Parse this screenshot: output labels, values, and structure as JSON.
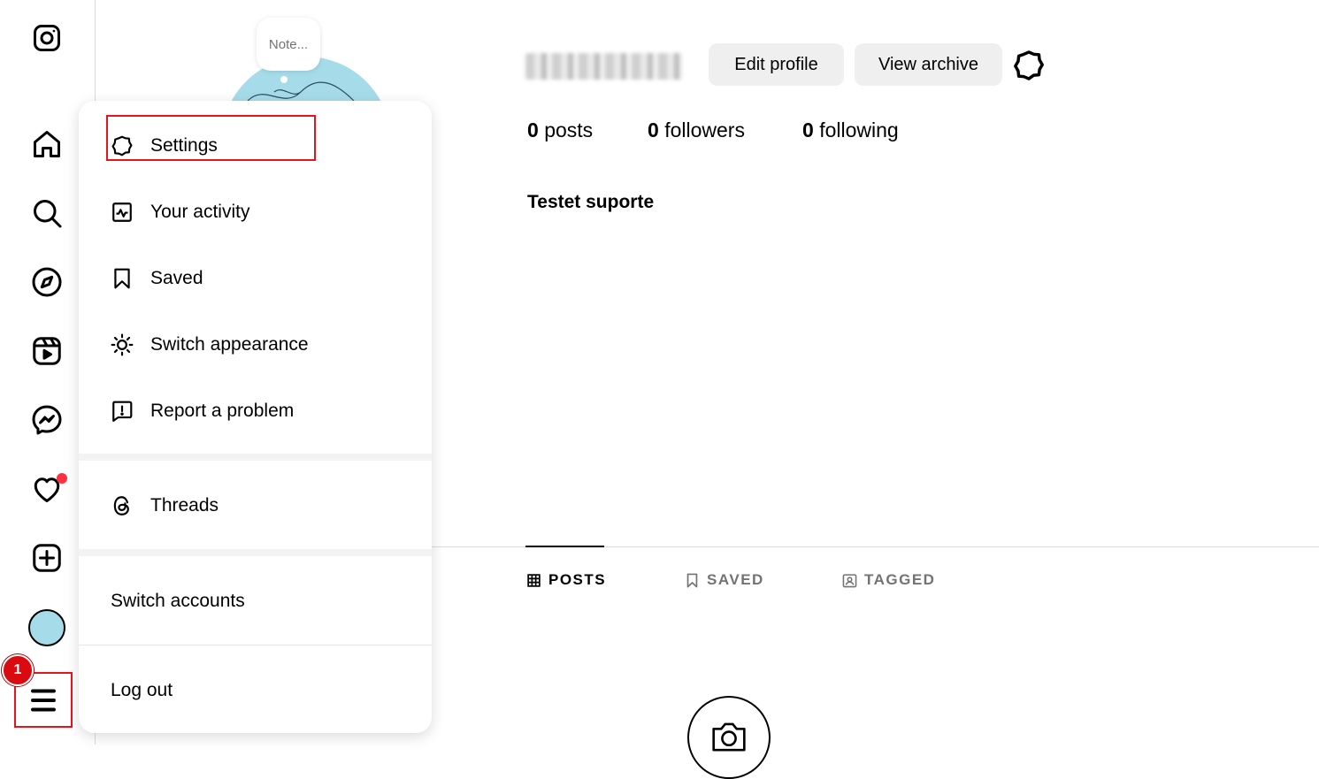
{
  "profile": {
    "note_text": "Note...",
    "edit_profile_label": "Edit profile",
    "view_archive_label": "View archive",
    "stats": [
      {
        "count": "0",
        "label": "posts"
      },
      {
        "count": "0",
        "label": "followers"
      },
      {
        "count": "0",
        "label": "following"
      }
    ],
    "display_name": "Testet suporte"
  },
  "tabs": [
    {
      "label": "POSTS",
      "icon": "grid-icon",
      "active": true
    },
    {
      "label": "SAVED",
      "icon": "bookmark-icon",
      "active": false
    },
    {
      "label": "TAGGED",
      "icon": "tagged-icon",
      "active": false
    }
  ],
  "menu": {
    "items": [
      {
        "label": "Settings",
        "icon": "settings-icon"
      },
      {
        "label": "Your activity",
        "icon": "activity-icon"
      },
      {
        "label": "Saved",
        "icon": "bookmark-icon"
      },
      {
        "label": "Switch appearance",
        "icon": "sun-icon"
      },
      {
        "label": "Report a problem",
        "icon": "report-icon"
      },
      {
        "label": "Threads",
        "icon": "threads-icon"
      },
      {
        "label": "Switch accounts",
        "icon": ""
      },
      {
        "label": "Log out",
        "icon": ""
      }
    ]
  },
  "annotation": {
    "step_number": "1",
    "highlight_color": "#e8141c"
  },
  "colors": {
    "notification_dot": "#ff3040",
    "avatar_bg": "#a6dce9",
    "button_bg": "#efefef"
  }
}
